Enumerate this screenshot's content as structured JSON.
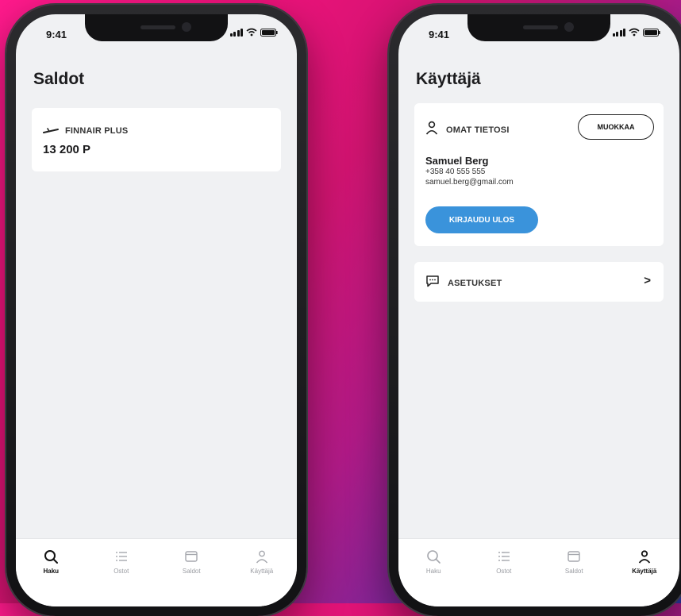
{
  "status": {
    "time": "9:41"
  },
  "left": {
    "title": "Saldot",
    "balance_card": {
      "program": "FINNAIR PLUS",
      "amount": "13 200 P"
    }
  },
  "right": {
    "title": "Käyttäjä",
    "profile_card": {
      "heading": "OMAT TIETOSI",
      "edit_button": "MUOKKAA",
      "name": "Samuel Berg",
      "phone": "+358 40 555 555",
      "email": "samuel.berg@gmail.com",
      "logout_button": "KIRJAUDU ULOS"
    },
    "settings_row": {
      "label": "ASETUKSET",
      "chevron": ">"
    }
  },
  "tabbar": {
    "tabs": [
      {
        "label": "Haku",
        "icon": "search-icon"
      },
      {
        "label": "Ostot",
        "icon": "list-icon"
      },
      {
        "label": "Saldot",
        "icon": "wallet-icon"
      },
      {
        "label": "Käyttäjä",
        "icon": "user-icon"
      }
    ]
  },
  "colors": {
    "primary_button": "#3a93db",
    "screen_bg": "#f0f1f3"
  }
}
